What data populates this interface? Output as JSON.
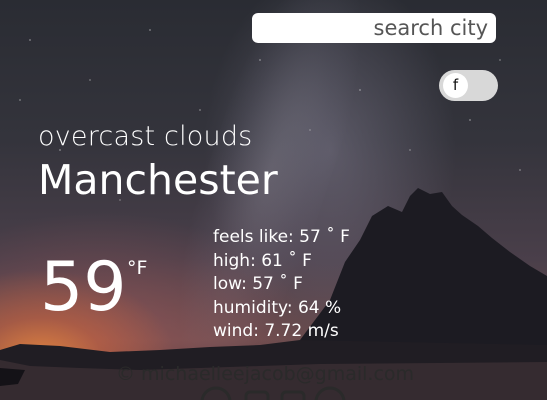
{
  "search": {
    "placeholder": "search city"
  },
  "units_toggle": {
    "label": "f"
  },
  "weather": {
    "description": "overcast clouds",
    "city": "Manchester",
    "temperature": "59",
    "temperature_unit": "°F",
    "feels_like": "feels like: 57 ˚ F",
    "high": "high: 61 ˚ F",
    "low": "low: 57 ˚ F",
    "humidity": "humidity: 64 %",
    "wind": "wind: 7.72 m/s"
  },
  "footer": {
    "credit": "© michaelleejacob@gmail.com"
  },
  "colors": {
    "text": "#ffffff",
    "footer_text": "#2a2a2a",
    "search_bg": "#ffffff",
    "toggle_bg": "#d8d8d8"
  }
}
